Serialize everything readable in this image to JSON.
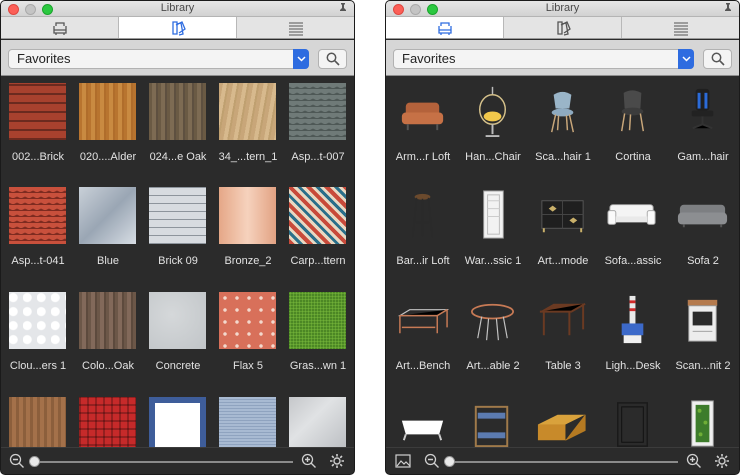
{
  "window_title": "Library",
  "filter": {
    "selected": "Favorites"
  },
  "slider": {
    "value": 0
  },
  "left": {
    "active_tab": "materials",
    "items": [
      {
        "label": "002...Brick",
        "kind": "brick"
      },
      {
        "label": "020....Alder",
        "kind": "wood-light"
      },
      {
        "label": "024...e Oak",
        "kind": "wood-gray"
      },
      {
        "label": "34_...tern_1",
        "kind": "wood-beige"
      },
      {
        "label": "Asp...t-007",
        "kind": "shingle-gray"
      },
      {
        "label": "Asp...t-041",
        "kind": "shingle-red"
      },
      {
        "label": "Blue",
        "kind": "metal-blue"
      },
      {
        "label": "Brick 09",
        "kind": "brick-white"
      },
      {
        "label": "Bronze_2",
        "kind": "bronze"
      },
      {
        "label": "Carp...ttern",
        "kind": "carpet"
      },
      {
        "label": "Clou...ers 1",
        "kind": "clouds"
      },
      {
        "label": "Colo...Oak",
        "kind": "wood-dark"
      },
      {
        "label": "Concrete",
        "kind": "concrete"
      },
      {
        "label": "Flax 5",
        "kind": "flax"
      },
      {
        "label": "Gras...wn 1",
        "kind": "grass"
      },
      {
        "label": "",
        "kind": "wood-brown"
      },
      {
        "label": "",
        "kind": "tartan"
      },
      {
        "label": "",
        "kind": "tile-delft"
      },
      {
        "label": "",
        "kind": "fabric-blue"
      },
      {
        "label": "",
        "kind": "marble"
      }
    ]
  },
  "right": {
    "active_tab": "furniture",
    "items": [
      {
        "label": "Arm...r Loft",
        "icon": "armchair-icon"
      },
      {
        "label": "Han...Chair",
        "icon": "hanging-chair-icon"
      },
      {
        "label": "Sca...hair 1",
        "icon": "scandi-chair-icon"
      },
      {
        "label": "Cortina",
        "icon": "cortina-chair-icon"
      },
      {
        "label": "Gam...hair",
        "icon": "gaming-chair-icon"
      },
      {
        "label": "Bar...ir Loft",
        "icon": "bar-stool-icon"
      },
      {
        "label": "War...ssic 1",
        "icon": "wardrobe-icon"
      },
      {
        "label": "Art...mode",
        "icon": "commode-icon"
      },
      {
        "label": "Sofa...assic",
        "icon": "sofa-classic-icon"
      },
      {
        "label": "Sofa 2",
        "icon": "sofa-icon"
      },
      {
        "label": "Art...Bench",
        "icon": "bench-icon"
      },
      {
        "label": "Art...able 2",
        "icon": "round-table-icon"
      },
      {
        "label": "Table 3",
        "icon": "table-icon"
      },
      {
        "label": "Ligh...Desk",
        "icon": "lighthouse-desk-icon"
      },
      {
        "label": "Scan...nit 2",
        "icon": "kitchen-unit-icon"
      },
      {
        "label": "",
        "icon": "bathtub-icon"
      },
      {
        "label": "",
        "icon": "bunk-bed-icon"
      },
      {
        "label": "",
        "icon": "bed-icon"
      },
      {
        "label": "",
        "icon": "frame-icon"
      },
      {
        "label": "",
        "icon": "plant-wall-icon"
      }
    ]
  }
}
